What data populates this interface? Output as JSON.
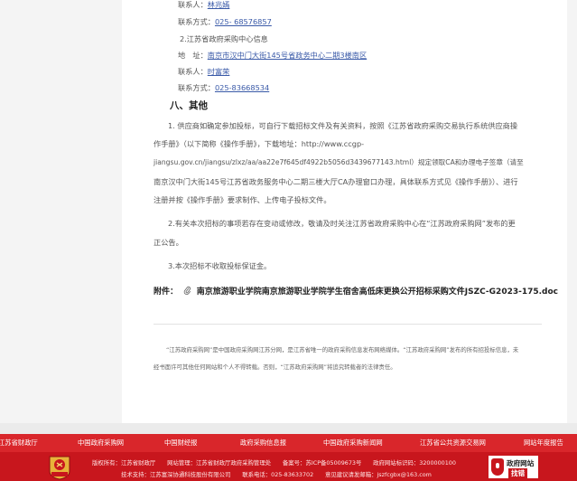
{
  "contact": {
    "c1_label": "联系人：",
    "c1_name": "林兆嫣",
    "c1_phone_label": "联系方式：",
    "c1_phone": "025- 68576857",
    "center_title": "2.江苏省政府采购中心信息",
    "addr_label": "地　址：",
    "addr_value": "南京市汉中门大街145号省政务中心二期3楼南区",
    "c2_label": "联系人：",
    "c2_name": "时富荣",
    "c2_phone_label": "联系方式：",
    "c2_phone": "025-83668534"
  },
  "section8": {
    "heading": "八、其他",
    "p1_l1": "1. 供应商如确定参加投标，可自行下载招标文件及有关资料，按照《江苏省政府采购交易执行系统供应商操",
    "p1_l2": "作手册》（以下简称《操作手册》，下载地址：http://www.ccgp-",
    "p1_l3": "jiangsu.gov.cn/jiangsu/zlxz/aa/aa22e7f645df4922b5056d3439677143.html）规定领取CA和办理电子签章（请至",
    "p1_l4": "南京汉中门大街145号江苏省政务服务中心二期三楼大厅CA办理窗口办理，具体联系方式见《操作手册》）、进行",
    "p1_l5": "注册并按《操作手册》要求制作、上传电子投标文件。",
    "p2_l1": "2.有关本次招标的事项若存在变动或修改，敬请及时关注江苏省政府采购中心在“江苏政府采购网”发布的更",
    "p2_l2": "正公告。",
    "p3": "3.本次招标不收取投标保证金。"
  },
  "attachment": {
    "label": "附件：",
    "icon": "paperclip-icon",
    "file": "南京旅游职业学院南京旅游职业学院学生宿舍高低床更换公开招标采购文件JSZC-G2023-175.doc"
  },
  "note": {
    "l1": "“江苏政府采购网”是中国政府采购网江苏分网，是江苏省唯一的政府采购信息发布网络媒体。“江苏政府采购网”发布的所有招投标信息，未",
    "l2": "经书面许可其他任何网站和个人不得转载。否则，“江苏政府采购网”将追究转载者的法律责任。"
  },
  "nav": {
    "items": [
      "江苏省财政厅",
      "中国政府采购网",
      "中国财经报",
      "政府采购信息报",
      "中国政府采购新闻网",
      "江苏省公共资源交易网",
      "网站年度报告"
    ]
  },
  "footer": {
    "line1": "版权所有：江苏省财政厅　　网站管理：江苏省财政厅政府采购管理处　　备案号：苏ICP备05009673号　　政府网站标识码：3200000100",
    "line2": "技术支持：江苏富深协通科技股份有限公司　　联系电话：025-83633702　　意见建议请发邮箱：jszfcgbx@163.com",
    "badge_top": "政府网站",
    "badge_bottom": "找错",
    "emblem_text": "党政机关",
    "brand_red": "#c8161d"
  }
}
